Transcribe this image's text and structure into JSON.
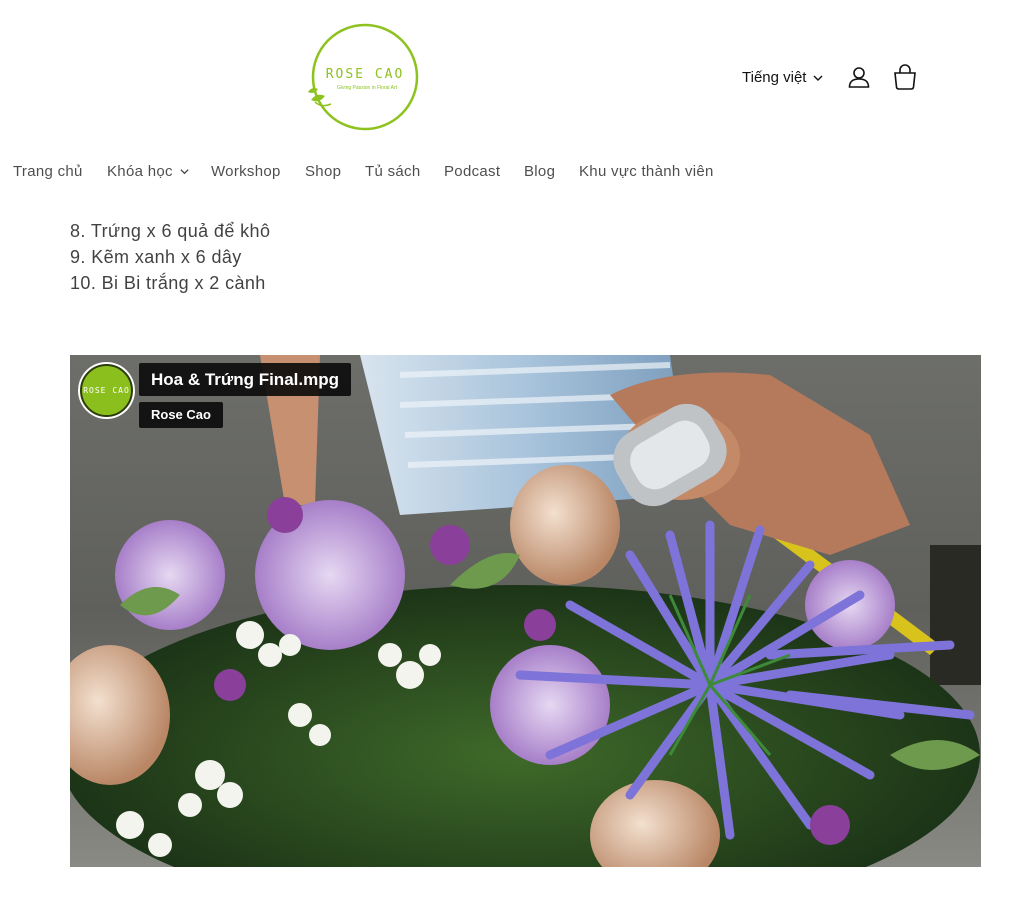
{
  "header": {
    "logo": {
      "brand": "ROSE CAO",
      "tagline": "Giving Passion in Floral Art",
      "ring_color": "#8dc21f",
      "text_color": "#8dc21f"
    },
    "language_label": "Tiếng việt",
    "icons": [
      "chevron-down-icon",
      "account-icon",
      "cart-icon"
    ]
  },
  "nav": {
    "items": [
      {
        "label": "Trang chủ"
      },
      {
        "label": "Khóa học",
        "has_dropdown": true
      },
      {
        "label": "Workshop"
      },
      {
        "label": "Shop"
      },
      {
        "label": "Tủ sách"
      },
      {
        "label": "Podcast"
      },
      {
        "label": "Blog"
      },
      {
        "label": "Khu vực thành viên"
      }
    ]
  },
  "content": {
    "materials": [
      "8. Trứng x 6 quả để khô",
      "9. Kẽm xanh x 6 dây",
      "10. Bi Bi trắng x 2 cành"
    ]
  },
  "video": {
    "title": "Hoa & Trứng Final.mpg",
    "channel": "Rose Cao",
    "avatar_text": "ROSE CAO",
    "avatar_color": "#8bbf1d"
  }
}
